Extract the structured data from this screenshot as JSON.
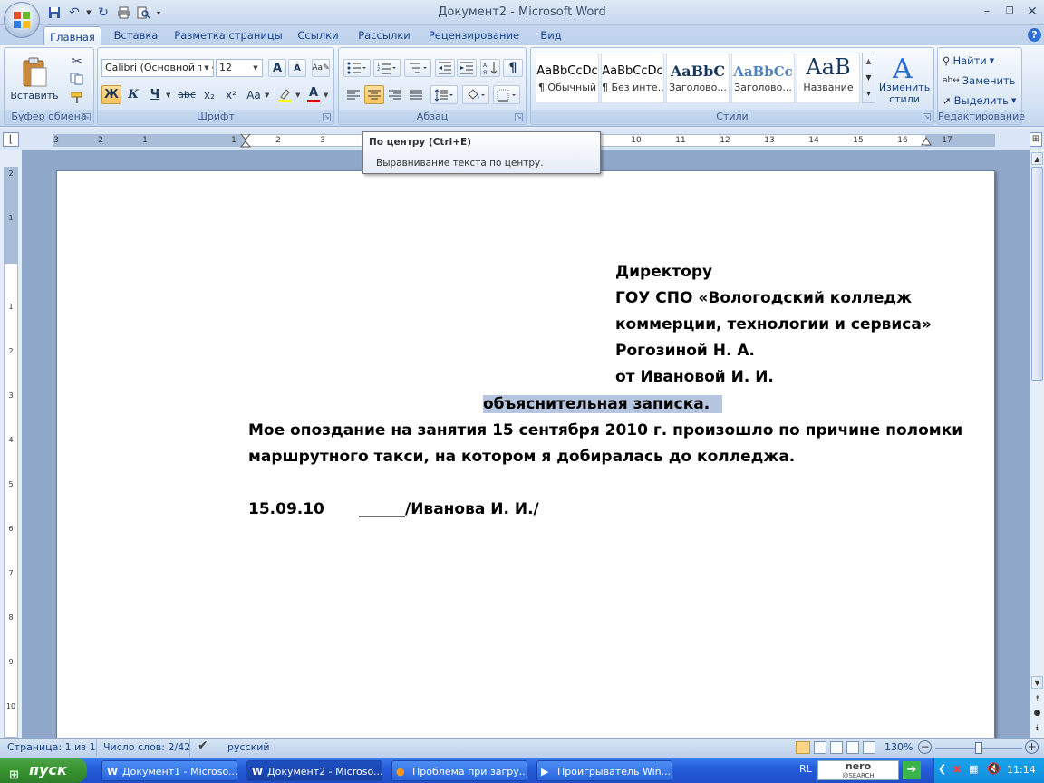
{
  "window": {
    "title": "Документ2 - Microsoft Word"
  },
  "ribbon_tabs": [
    "Главная",
    "Вставка",
    "Разметка страницы",
    "Ссылки",
    "Рассылки",
    "Рецензирование",
    "Вид"
  ],
  "clipboard": {
    "paste_label": "Вставить",
    "group_label": "Буфер обмена"
  },
  "font": {
    "name": "Calibri (Основной текст)",
    "size": "12",
    "group_label": "Шрифт",
    "bold": "Ж",
    "italic": "К",
    "underline": "Ч",
    "strike": "abc",
    "subscript": "x₂",
    "superscript": "x²",
    "case": "Aa",
    "grow": "A",
    "shrink": "A",
    "font_color": "A"
  },
  "paragraph": {
    "group_label": "Абзац"
  },
  "styles": {
    "group_label": "Стили",
    "items": [
      {
        "sample": "AaBbCcDc",
        "name": "¶ Обычный"
      },
      {
        "sample": "AaBbCcDc",
        "name": "¶ Без инте..."
      },
      {
        "sample": "AaBbC",
        "name": "Заголово..."
      },
      {
        "sample": "AaBbCc",
        "name": "Заголово..."
      },
      {
        "sample": "AaB",
        "name": "Название"
      }
    ],
    "change_label_1": "Изменить",
    "change_label_2": "стили"
  },
  "editing": {
    "group_label": "Редактирование",
    "find": "Найти",
    "replace": "Заменить",
    "select": "Выделить"
  },
  "tooltip": {
    "title": "По центру (Ctrl+E)",
    "description": "Выравнивание текста по центру."
  },
  "ruler": {
    "numbers": [
      "3",
      "2",
      "1",
      "1",
      "2",
      "3",
      "10",
      "11",
      "12",
      "13",
      "14",
      "15",
      "16",
      "17"
    ],
    "vnumbers": [
      "2",
      "1",
      "1",
      "2",
      "3",
      "4",
      "5",
      "6",
      "7",
      "8",
      "9",
      "10"
    ]
  },
  "document": {
    "header_lines": [
      "Директору",
      "ГОУ СПО «Вологодский колледж",
      "коммерции, технологии и сервиса»",
      "Рогозиной Н. А.",
      "от Ивановой  И. И."
    ],
    "title_part1": "объяснительная",
    "title_part2": " записка.",
    "body_lines": [
      "Мое опоздание на занятия 15 сентября 2010 г. произошло по причине поломки",
      "маршрутного такси, на котором я добиралась до колледжа."
    ],
    "signature_date": "15.09.10",
    "signature_line": "______/Иванова  И. И./"
  },
  "status": {
    "page": "Страница: 1 из 1",
    "words": "Число слов: 2/42",
    "language": "русский",
    "zoom": "130%"
  },
  "taskbar": {
    "start": "пуск",
    "tasks": [
      "Документ1 - Microso...",
      "Документ2 - Microso...",
      "Проблема при загру...",
      "Проигрыватель Win..."
    ],
    "lang": "RL",
    "nero": "nero",
    "nero_sub": "@SEARCH",
    "clock": "11:14"
  },
  "colors": {
    "accent": "#15428b",
    "selection": "#b6c6e0",
    "taskbar": "#245ddb"
  }
}
